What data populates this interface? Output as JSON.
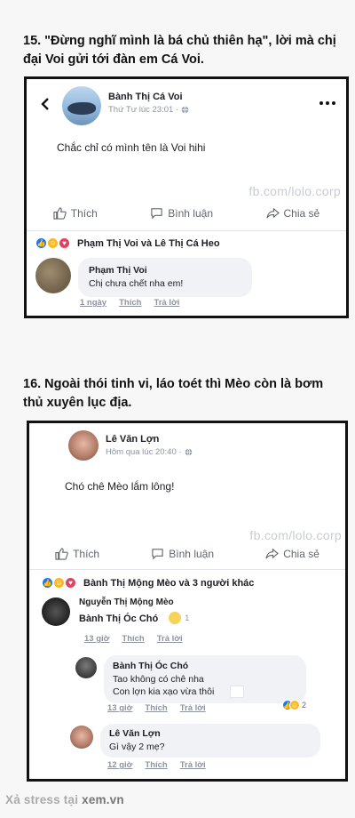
{
  "section15": {
    "heading": "15. \"Đừng nghĩ mình là bá chủ thiên hạ\", lời mà chị đại Voi gửi tới đàn em Cá Voi.",
    "post": {
      "author": "Bành Thị Cá Voi",
      "time": "Thứ Tư lúc 23:01 ·",
      "text": "Chắc chỉ có mình tên là Voi hihi",
      "watermark": "fb.com/lolo.corp"
    },
    "actions": {
      "like": "Thích",
      "comment": "Bình luận",
      "share": "Chia sẻ"
    },
    "reactions_text": "Phạm Thị Voi và Lê Thị Cá Heo",
    "comment": {
      "name": "Phạm Thị Voi",
      "text": "Chị chưa chết nha em!",
      "time": "1 ngày",
      "like": "Thích",
      "reply": "Trả lời"
    }
  },
  "section16": {
    "heading": "16. Ngoài thói tinh vi, láo toét thì Mèo còn là bơm thủ xuyên lục địa.",
    "post": {
      "author": "Lê Văn Lợn",
      "time": "Hôm qua lúc 20:40 ·",
      "text": "Chó chê Mèo lắm lông!",
      "watermark": "fb.com/lolo.corp"
    },
    "actions": {
      "like": "Thích",
      "comment": "Bình luận",
      "share": "Chia sẻ"
    },
    "reactions_text": "Bành Thị Mộng Mèo và 3 người khác",
    "comments": [
      {
        "name": "Nguyễn Thị Mộng Mèo",
        "text": "Bành Thị Óc Chó",
        "reaction_count": "1",
        "time": "13 giờ",
        "like": "Thích",
        "reply": "Trả lời"
      },
      {
        "name": "Bành Thị Óc Chó",
        "text1": "Tao không có chê nha",
        "text2": "Con lợn kia xạo vừa thôi",
        "reaction_count": "2",
        "time": "13 giờ",
        "like": "Thích",
        "reply": "Trả lời"
      },
      {
        "name": "Lê Văn Lợn",
        "text": "Gì vậy 2 mẹ?",
        "time": "12 giờ",
        "like": "Thích",
        "reply": "Trả lời"
      }
    ]
  },
  "footer": {
    "prefix": "Xả stress tại",
    "site": "xem.vn"
  },
  "colors": {
    "fb_blue": "#1877f2",
    "muted": "#8d949e",
    "bubble": "#f0f2f5"
  }
}
